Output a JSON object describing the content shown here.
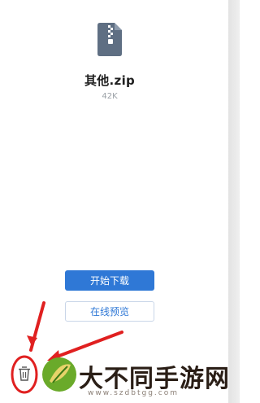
{
  "file": {
    "icon": "zip-file-icon",
    "name": "其他.zip",
    "size": "42K"
  },
  "actions": {
    "download_label": "开始下载",
    "preview_label": "在线预览"
  },
  "toolbar": {
    "delete_icon": "trash-icon"
  },
  "watermark": {
    "title": "大不同手游网",
    "url": "www.szdbtgg.com"
  },
  "colors": {
    "primary": "#2f78d6",
    "annotation": "#e02020",
    "file_icon": "#5f6f83"
  }
}
